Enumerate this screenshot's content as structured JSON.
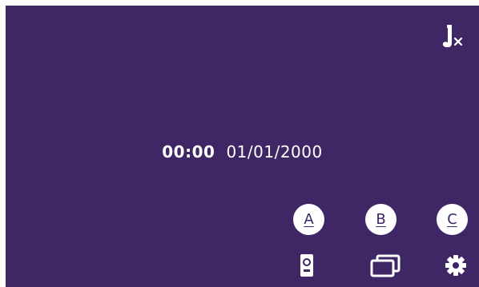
{
  "status": {
    "time": "00:00",
    "date": "01/01/2000"
  },
  "top_controls": {
    "mute_icon": "music-note-mute-icon"
  },
  "quick_buttons": [
    {
      "label": "A"
    },
    {
      "label": "B"
    },
    {
      "label": "C"
    }
  ],
  "bottom_bar": {
    "icons": [
      "door-panel-icon",
      "multi-window-icon",
      "gear-icon"
    ]
  },
  "colors": {
    "background": "#3f2664",
    "foreground": "#ffffff"
  }
}
